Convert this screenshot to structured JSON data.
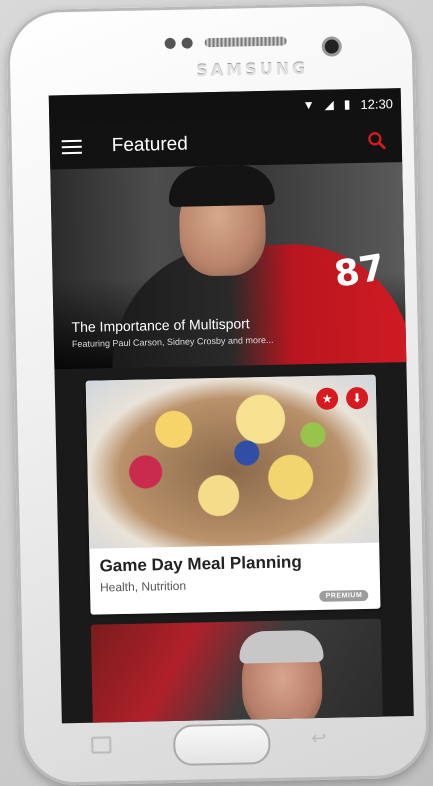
{
  "device": {
    "brand": "SAMSUNG"
  },
  "status_bar": {
    "time": "12:30"
  },
  "app_bar": {
    "title": "Featured"
  },
  "hero": {
    "title": "The Importance of Multisport",
    "subtitle": "Featuring Paul Carson, Sidney Crosby and more...",
    "jersey_number": "87"
  },
  "cards": [
    {
      "title": "Game Day Meal Planning",
      "tags": "Health, Nutrition",
      "badge": "PREMIUM",
      "favorite_icon": "star-icon",
      "download_icon": "download-icon"
    }
  ],
  "colors": {
    "accent": "#d71920",
    "appbar": "#121212",
    "screen_bg": "#1a1a1a"
  },
  "icons": {
    "menu": "hamburger-icon",
    "search": "search-icon",
    "wifi": "wifi-icon",
    "signal": "signal-icon",
    "battery": "battery-icon"
  }
}
